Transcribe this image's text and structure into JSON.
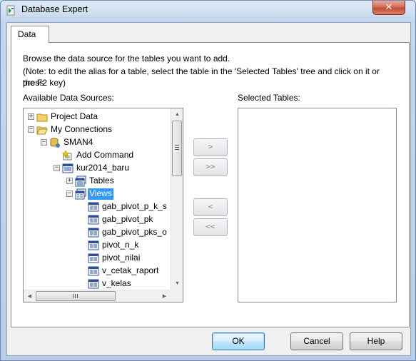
{
  "window": {
    "title": "Database Expert",
    "close_label": "✕"
  },
  "tab": {
    "label": "Data"
  },
  "description": {
    "line1": "Browse the data source for the tables you want to add.",
    "line2": "(Note: to edit the alias for a table, select the table in the 'Selected Tables' tree and click on it or press",
    "line3": "the F2 key)"
  },
  "available_label": "Available Data Sources:",
  "selected_label": "Selected Tables:",
  "tree": [
    {
      "label": "Project Data",
      "icon": "folder-icon",
      "expander": "+"
    },
    {
      "label": "My Connections",
      "icon": "folder-open-icon",
      "expander": "−"
    },
    {
      "label": "SMAN4",
      "icon": "database-connection-icon",
      "expander": "−"
    },
    {
      "label": "Add Command",
      "icon": "add-command-icon",
      "expander": ""
    },
    {
      "label": "kur2014_baru",
      "icon": "database-icon",
      "expander": "−"
    },
    {
      "label": "Tables",
      "icon": "tables-icon",
      "expander": "+"
    },
    {
      "label": "Views",
      "icon": "views-icon",
      "expander": "−",
      "selected": true
    },
    {
      "label": "gab_pivot_p_k_s",
      "icon": "view-icon",
      "expander": ""
    },
    {
      "label": "gab_pivot_pk",
      "icon": "view-icon",
      "expander": ""
    },
    {
      "label": "gab_pivot_pks_o",
      "icon": "view-icon",
      "expander": ""
    },
    {
      "label": "pivot_n_k",
      "icon": "view-icon",
      "expander": ""
    },
    {
      "label": "pivot_nilai",
      "icon": "view-icon",
      "expander": ""
    },
    {
      "label": "v_cetak_raport",
      "icon": "view-icon",
      "expander": ""
    },
    {
      "label": "v_kelas",
      "icon": "view-icon",
      "expander": ""
    }
  ],
  "move_buttons": {
    "add": ">",
    "add_all": ">>",
    "remove": "<",
    "remove_all": "<<"
  },
  "buttons": {
    "ok": "OK",
    "cancel": "Cancel",
    "help": "Help"
  },
  "colors": {
    "selection": "#3399ff",
    "titlebar": "#c4d6ec",
    "close": "#c24a32"
  }
}
